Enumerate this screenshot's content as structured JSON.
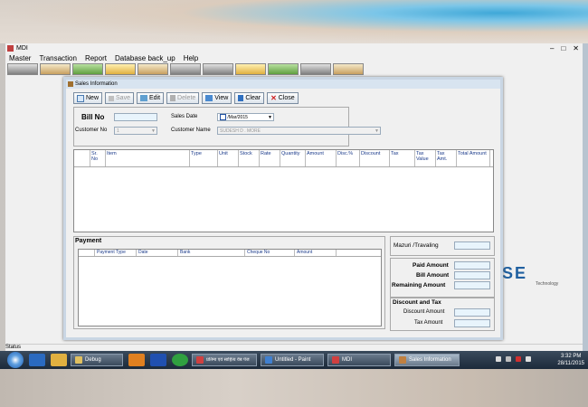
{
  "mdi": {
    "title": "MDI",
    "menus": [
      "Master",
      "Transaction",
      "Report",
      "Database back_up",
      "Help"
    ],
    "win_min": "–",
    "win_max": "□",
    "win_close": "✕",
    "status": "Status"
  },
  "logo": {
    "text": "NSE",
    "sub": "Technology"
  },
  "dialog": {
    "title": "Sales Information",
    "buttons": {
      "new": "New",
      "save": "Save",
      "edit": "Edit",
      "delete": "Delete",
      "view": "View",
      "clear": "Clear",
      "close": "Close"
    },
    "bill_no_label": "Bill No",
    "sales_date_label": "Sales Date",
    "sales_date_value": "/Mar/2015",
    "customer_no_label": "Customer No",
    "customer_no_value": "1",
    "customer_name_label": "Customer Name",
    "customer_name_value": "SUDESH  D . MORE",
    "grid_columns": [
      "Sr. No",
      "Item",
      "Type",
      "Unit",
      "Stock",
      "Rate",
      "Quantity",
      "Amount",
      "Disc.%",
      "Discount",
      "Tax",
      "Tax Value",
      "Tax Amt.",
      "Total Amount"
    ],
    "payment_title": "Payment",
    "payment_columns": [
      "Payment Type",
      "Date",
      "Bank",
      "Cheque No",
      "Amount"
    ],
    "mazuri_label": "Mazuri /Travaling",
    "paid_amount_label": "Paid Amount",
    "bill_amount_label": "Bill Amount",
    "remaining_amount_label": "Remaining Amount",
    "disc_tax_title": "Discount and Tax",
    "discount_amount_label": "Discount Amount",
    "tax_amount_label": "Tax Amount"
  },
  "taskbar": {
    "tasks": [
      {
        "label": "Debug",
        "color": "#e0c060"
      },
      {
        "label": "प्रतिमा एवं साहित्य वेब पेज",
        "color": "#d04040"
      },
      {
        "label": "Untitled - Paint",
        "color": "#4080d0"
      },
      {
        "label": "MDI",
        "color": "#d04040"
      },
      {
        "label": "Sales Information",
        "color": "#c08040"
      }
    ],
    "time": "3:32 PM",
    "date": "28/11/2015"
  }
}
